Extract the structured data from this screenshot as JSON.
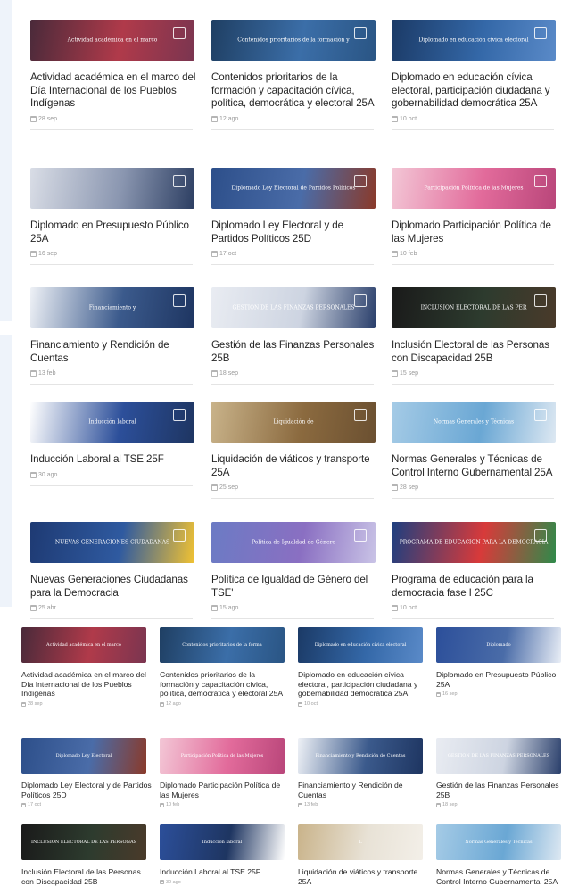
{
  "cards_large": [
    {
      "title": "Actividad académica en el marco del Día Internacional de los Pueblos Indígenas",
      "date": "28 sep",
      "banner": "Actividad académica en el marco",
      "colors": [
        "#4a2a3a",
        "#b03a4a",
        "#7a3550"
      ]
    },
    {
      "title": "Contenidos prioritarios de la formación y capacitación cívica, política, democrática y electoral 25A",
      "date": "12 ago",
      "banner": "Contenidos prioritarios de la formación y",
      "colors": [
        "#1f3f63",
        "#3b6ea8",
        "#2a5584"
      ]
    },
    {
      "title": "Diplomado en educación cívica electoral, participación ciudadana y gobernabilidad democrática 25A",
      "date": "10 oct",
      "banner": "Diplomado en educación cívica electoral",
      "colors": [
        "#1b3a66",
        "#3468a8",
        "#5a8ac8"
      ]
    },
    {
      "title": "Diplomado en Presupuesto Público 25A",
      "date": "16 sep",
      "banner": "",
      "colors": [
        "#d9dde6",
        "#8a96b0",
        "#2c3e62"
      ]
    },
    {
      "title": "Diplomado Ley Electoral y de Partidos Políticos 25D",
      "date": "17 oct",
      "banner": "Diplomado Ley Electoral de Partidos Políticos",
      "colors": [
        "#2d4f8a",
        "#4a6ca8",
        "#8a3a2a"
      ]
    },
    {
      "title": "Diplomado Participación Política de las Mujeres",
      "date": "10 feb",
      "banner": "Participación Política de las Mujeres",
      "colors": [
        "#f3c7d6",
        "#e26b9b",
        "#b9467a"
      ]
    },
    {
      "title": "Financiamiento y Rendición de Cuentas",
      "date": "13 feb",
      "banner": "Financiamiento y",
      "colors": [
        "#eef1f6",
        "#3b5a8c",
        "#1e3561"
      ]
    },
    {
      "title": "Gestión de las Finanzas Personales 25B",
      "date": "18 sep",
      "banner": "GESTIÓN DE LAS FINANZAS PERSONALES",
      "colors": [
        "#e9ecf2",
        "#cdd4e1",
        "#2a3f6b"
      ]
    },
    {
      "title": "Inclusión Electoral de las Personas con Discapacidad 25B",
      "date": "15 sep",
      "banner": "INCLUSIÓN ELECTORAL DE LAS PER",
      "colors": [
        "#1a1a1a",
        "#2d3b2e",
        "#4a3a2a"
      ]
    },
    {
      "title": "Inducción Laboral al TSE 25F",
      "date": "30 ago",
      "banner": "Inducción laboral",
      "colors": [
        "#ffffff",
        "#2c4f9a",
        "#1e3561"
      ]
    },
    {
      "title": "Liquidación de viáticos y transporte 25A",
      "date": "25 sep",
      "banner": "Liquidación de",
      "colors": [
        "#c9b38a",
        "#8b6a3f",
        "#6b5031"
      ]
    },
    {
      "title": "Normas Generales y Técnicas de Control Interno Gubernamental 25A",
      "date": "28 sep",
      "banner": "Normas Generales y Técnicas",
      "colors": [
        "#a5cbe6",
        "#6aa7d4",
        "#dde8f2"
      ]
    },
    {
      "title": "Nuevas Generaciones Ciudadanas para la Democracia",
      "date": "25 abr",
      "banner": "NUEVAS GENERACIONES CIUDADANAS",
      "colors": [
        "#1e3a73",
        "#2f5aa0",
        "#f1c232"
      ]
    },
    {
      "title": "Política de Igualdad de Género del TSE'",
      "date": "15 ago",
      "banner": "Política de Igualdad de Género",
      "colors": [
        "#6b7bc4",
        "#8a6fc2",
        "#c9c3e6"
      ]
    },
    {
      "title": "Programa de educación para la democracia fase I 25C",
      "date": "10 oct",
      "banner": "PROGRAMA DE EDUCACIÓN PARA LA DEMOCRACIA",
      "colors": [
        "#1d3f80",
        "#d83a3a",
        "#2f8a4a"
      ]
    }
  ],
  "cards_small": [
    {
      "title": "Actividad académica en el marco del Día Internacional de los Pueblos Indígenas",
      "date": "28 sep",
      "banner": "Actividad académica en el marco",
      "colors": [
        "#4a2a3a",
        "#b03a4a",
        "#7a3550"
      ]
    },
    {
      "title": "Contenidos prioritarios de la formación y capacitación cívica, política, democrática y electoral 25A",
      "date": "12 ago",
      "banner": "Contenidos prioritarios de la forma",
      "colors": [
        "#1f3f63",
        "#3b6ea8",
        "#2a5584"
      ]
    },
    {
      "title": "Diplomado en educación cívica electoral, participación ciudadana y gobernabilidad democrática 25A",
      "date": "10 oct",
      "banner": "Diplomado en educación cívica electoral",
      "colors": [
        "#1b3a66",
        "#3468a8",
        "#5a8ac8"
      ]
    },
    {
      "title": "Diplomado en Presupuesto Público 25A",
      "date": "16 sep",
      "banner": "Diplomado",
      "colors": [
        "#2c4f9a",
        "#4a6ca8",
        "#e9eef6"
      ]
    },
    {
      "title": "Diplomado Ley Electoral y de Partidos Políticos 25D",
      "date": "17 oct",
      "banner": "Diplomado Ley Electoral",
      "colors": [
        "#2d4f8a",
        "#4a6ca8",
        "#8a3a2a"
      ]
    },
    {
      "title": "Diplomado Participación Política de las Mujeres",
      "date": "10 feb",
      "banner": "Participación Política de las Mujeres",
      "colors": [
        "#f3c7d6",
        "#e26b9b",
        "#b9467a"
      ]
    },
    {
      "title": "Financiamiento y Rendición de Cuentas",
      "date": "13 feb",
      "banner": "Financiamiento y Rendición de Cuentas",
      "colors": [
        "#eef1f6",
        "#3b5a8c",
        "#1e3561"
      ]
    },
    {
      "title": "Gestión de las Finanzas Personales 25B",
      "date": "18 sep",
      "banner": "GESTIÓN DE LAS FINANZAS PERSONALES",
      "colors": [
        "#e9ecf2",
        "#cdd4e1",
        "#2a3f6b"
      ]
    },
    {
      "title": "Inclusión Electoral de las Personas con Discapacidad 25B",
      "date": "",
      "banner": "INCLUSIÓN ELECTORAL DE LAS PERSONAS",
      "colors": [
        "#1a1a1a",
        "#2d3b2e",
        "#4a3a2a"
      ]
    },
    {
      "title": "Inducción Laboral al TSE 25F",
      "date": "30 ago",
      "banner": "Inducción laboral",
      "colors": [
        "#2c4f9a",
        "#1e3561",
        "#ffffff"
      ]
    },
    {
      "title": "Liquidación de viáticos y transporte 25A",
      "date": "",
      "banner": "L",
      "colors": [
        "#c9b38a",
        "#e8e2d6",
        "#f3efe8"
      ]
    },
    {
      "title": "Normas Generales y Técnicas de Control Interno Gubernamental 25A",
      "date": "",
      "banner": "Normas Generales y Técnicas",
      "colors": [
        "#a5cbe6",
        "#6aa7d4",
        "#dde8f2"
      ]
    }
  ]
}
